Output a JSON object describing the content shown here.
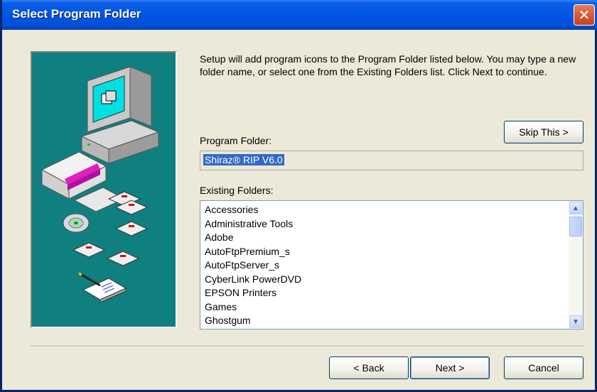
{
  "window": {
    "title": "Select Program Folder"
  },
  "description": "Setup will add program icons to the Program Folder listed below. You may type a new folder name, or select one from the Existing Folders list. Click Next to continue.",
  "skip_button": "Skip This >",
  "program_folder": {
    "label": "Program Folder:",
    "value": "Shiraz® RIP V6.0"
  },
  "existing_folders": {
    "label": "Existing Folders:",
    "items": [
      "Accessories",
      "Administrative Tools",
      "Adobe",
      "AutoFtpPremium_s",
      "AutoFtpServer_s",
      "CyberLink PowerDVD",
      "EPSON Printers",
      "Games",
      "Ghostgum"
    ]
  },
  "buttons": {
    "back": "< Back",
    "next": "Next >",
    "cancel": "Cancel"
  },
  "colors": {
    "title_bar": "#0054e3",
    "art_background": "#107f7f",
    "selection": "#316ac5"
  }
}
